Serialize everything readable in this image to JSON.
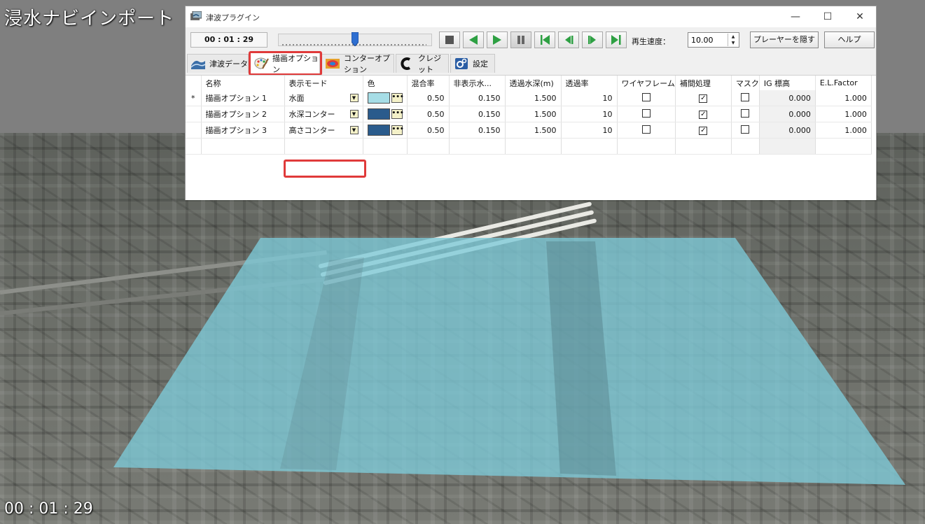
{
  "viewport": {
    "overlay_title": "浸水ナビインポート",
    "overlay_time": "00 : 01 : 29",
    "water_color": "#7ecad8"
  },
  "window": {
    "title": "津波プラグイン",
    "minimize_glyph": "—",
    "maximize_glyph": "☐",
    "close_glyph": "✕"
  },
  "toolbar": {
    "time": "00 : 01 : 29",
    "slider_fraction": 0.5,
    "buttons": [
      "stop",
      "play-reverse",
      "play",
      "pause",
      "first-frame",
      "step-back",
      "step-forward",
      "last-frame"
    ],
    "speed_label": "再生速度：",
    "speed_value": "10.00",
    "hide_player_label": "プレーヤーを隠す",
    "help_label": "ヘルプ"
  },
  "tabs": [
    {
      "label": "津波データ",
      "icon": "wave-icon",
      "active": false
    },
    {
      "label": "描画オプション",
      "icon": "palette-icon",
      "active": true
    },
    {
      "label": "コンターオプション",
      "icon": "contour-icon",
      "active": false
    },
    {
      "label": "クレジット",
      "icon": "credit-icon",
      "active": false
    },
    {
      "label": "設定",
      "icon": "gear-icon",
      "active": false
    }
  ],
  "grid": {
    "headers": [
      "",
      "名称",
      "表示モード",
      "色",
      "混合率",
      "非表示水...",
      "透過水深(m)",
      "透過率",
      "ワイヤフレーム",
      "補間処理",
      "マスク",
      "IG 標高",
      "E.L.Factor"
    ],
    "rows": [
      {
        "marker": "*",
        "name": "描画オプション 1",
        "mode": "水面",
        "color": "#a6dde6",
        "blend": "0.50",
        "hide_depth": "0.150",
        "trans_depth": "1.500",
        "transparency": "10",
        "wireframe": false,
        "interp": true,
        "mask": false,
        "ig": "0.000",
        "el_factor": "1.000"
      },
      {
        "marker": "",
        "name": "描画オプション 2",
        "mode": "水深コンター",
        "color": "#2a5b8c",
        "blend": "0.50",
        "hide_depth": "0.150",
        "trans_depth": "1.500",
        "transparency": "10",
        "wireframe": false,
        "interp": true,
        "mask": false,
        "ig": "0.000",
        "el_factor": "1.000"
      },
      {
        "marker": "",
        "name": "描画オプション 3",
        "mode": "高さコンター",
        "color": "#2a5b8c",
        "blend": "0.50",
        "hide_depth": "0.150",
        "trans_depth": "1.500",
        "transparency": "10",
        "wireframe": false,
        "interp": true,
        "mask": false,
        "ig": "0.000",
        "el_factor": "1.000"
      }
    ],
    "ellipsis": "•••",
    "combo_arrow": "▼",
    "check_mark": "✓"
  },
  "colors": {
    "highlight": "#e03a3a",
    "play_green": "#2ea043",
    "slider_thumb": "#2f6fd1"
  }
}
